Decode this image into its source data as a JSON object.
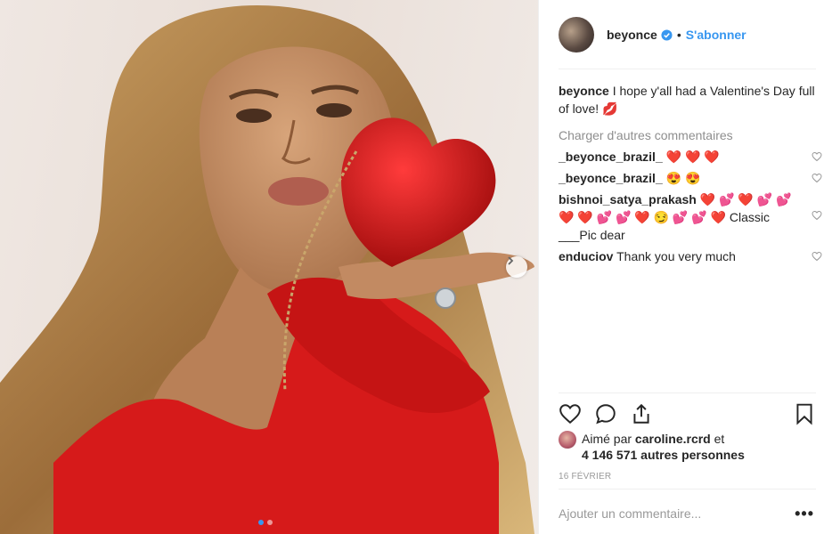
{
  "post": {
    "username": "beyonce",
    "separator": "•",
    "follow_label": "S'abonner",
    "caption": "I hope y'all had a Valentine's Day full of love! 💋",
    "load_more_label": "Charger d'autres commentaires",
    "comments": [
      {
        "user": "_beyonce_brazil_",
        "text": "❤️ ❤️ ❤️"
      },
      {
        "user": "_beyonce_brazil_",
        "text": "😍 😍"
      },
      {
        "user": "bishnoi_satya_prakash",
        "text": "❤️ 💕 ❤️ 💕 💕 ❤️ ❤️ 💕 💕 ❤️ 😏 💕 💕 ❤️ Classic ___Pic dear"
      },
      {
        "user": "enduciov",
        "text": "Thank you very much"
      }
    ],
    "likes": {
      "prefix": "Aimé par",
      "user": "caroline.rcrd",
      "connector": "et",
      "others": "4 146 571 autres personnes"
    },
    "date": "16 FÉVRIER",
    "add_comment_placeholder": "Ajouter un commentaire...",
    "more_label": "•••"
  },
  "icons": {
    "verified": "verified-badge-icon",
    "like": "heart-icon",
    "comment": "comment-bubble-icon",
    "share": "share-icon",
    "save": "bookmark-icon",
    "next": "chevron-right-icon"
  },
  "colors": {
    "link_blue": "#3897f0",
    "text": "#262626",
    "muted": "#999999",
    "dress_red": "#d61a1a"
  },
  "carousel": {
    "slides": 2,
    "active": 1
  }
}
